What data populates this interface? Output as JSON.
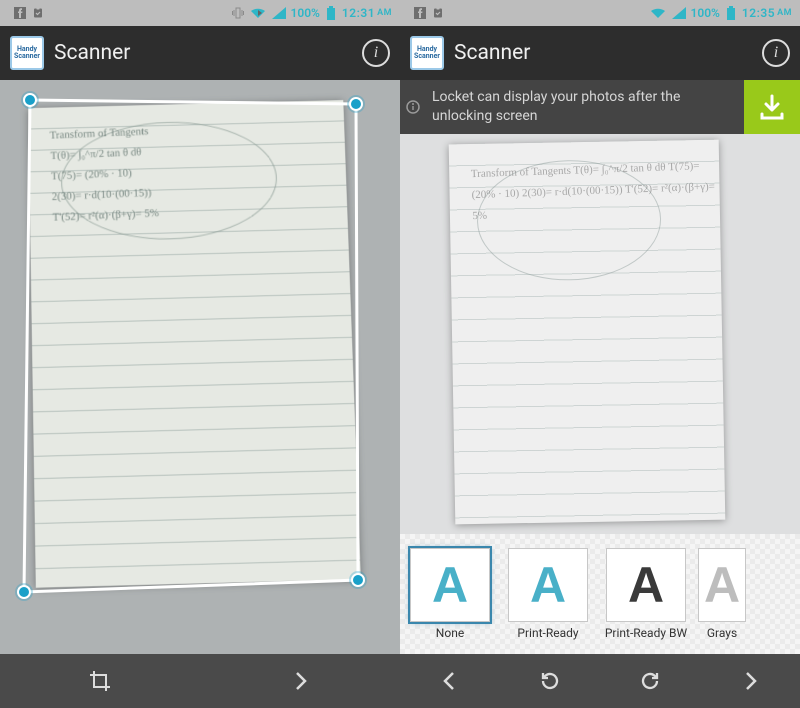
{
  "left": {
    "status": {
      "battery_pct": "100%",
      "time": "12:31",
      "ampm": "AM"
    },
    "title": "Scanner",
    "appicon_text": "Handy\nScanner",
    "paper_text": "Transform of Tangents\nT(θ)= ∫₀^π/2 tan θ dθ\nT(75)= (20% · 10)\n2(30)= r·d(10·(00·15))\nT'(52)= r²(α)·(β+γ)= 5%",
    "footer": {
      "crop": "crop",
      "next": "next"
    }
  },
  "right": {
    "status": {
      "battery_pct": "100%",
      "time": "12:35",
      "ampm": "AM"
    },
    "title": "Scanner",
    "appicon_text": "Handy\nScanner",
    "banner": "Locket can display your photos after the unlocking screen",
    "paper_text": "Transform of Tangents\nT(θ)= ∫₀^π/2 tan θ dθ\nT(75)= (20% · 10)\n2(30)= r·d(10·(00·15))\nT'(52)= r²(α)·(β+γ)= 5%",
    "filters": [
      {
        "label": "None",
        "glyph": "A",
        "color": "#49b0c8",
        "selected": true
      },
      {
        "label": "Print-Ready",
        "glyph": "A",
        "color": "#49b0c8",
        "selected": false
      },
      {
        "label": "Print-Ready BW",
        "glyph": "A",
        "color": "#3a3a3a",
        "selected": false
      },
      {
        "label": "Grays",
        "glyph": "A",
        "color": "#bdbdbd",
        "selected": false,
        "cut": true
      }
    ],
    "footer": {
      "prev": "prev",
      "undo": "undo",
      "redo": "redo",
      "next": "next"
    }
  }
}
